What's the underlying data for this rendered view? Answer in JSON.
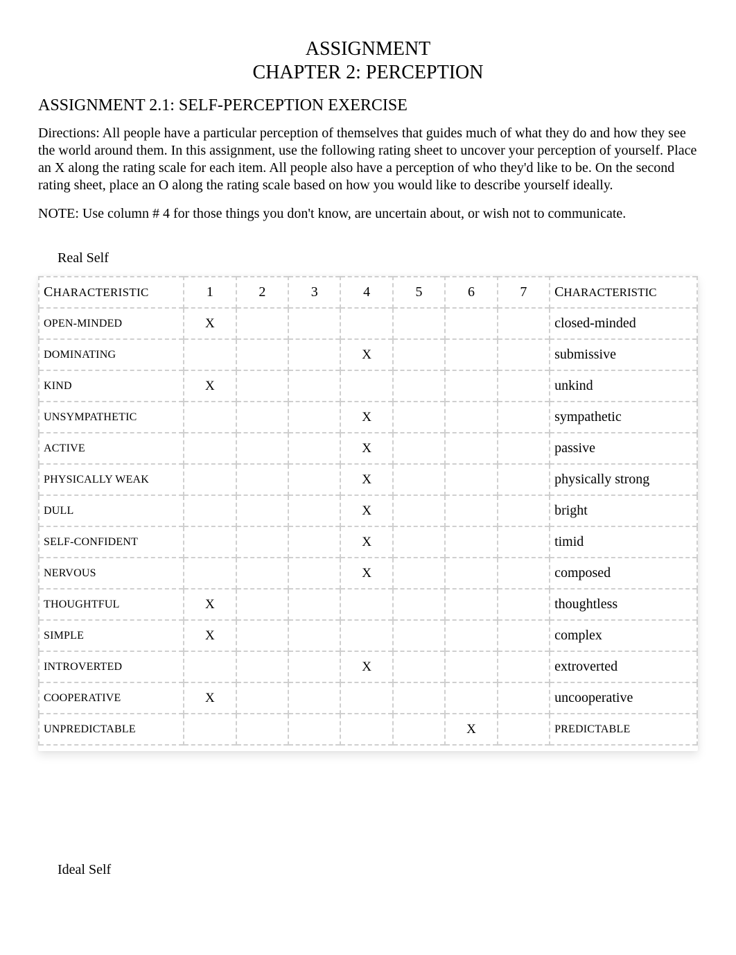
{
  "header": {
    "title_main": "ASSIGNMENT",
    "title_sub": "CHAPTER 2: PERCEPTION"
  },
  "assignment_heading": "ASSIGNMENT 2.1: SELF-PERCEPTION EXERCISE",
  "directions": "Directions:  All people have a particular perception of themselves that guides much of what they do and how they see the world around them. In this assignment, use the following rating sheet to uncover your perception of yourself. Place an X along the rating scale for each item. All people also have a perception of who they'd like to be. On the second rating sheet, place an O along the rating scale based on how you would like to describe yourself ideally.",
  "note": "NOTE:  Use column # 4 for those things you don't know, are uncertain about, or wish not to communicate.",
  "sections": {
    "real_self_label": "Real Self",
    "ideal_self_label": "Ideal Self"
  },
  "table": {
    "header_left_cap": "C",
    "header_left_rest": "HARACTERISTIC",
    "header_right_cap": "C",
    "header_right_rest": "HARACTERISTIC",
    "columns": [
      "1",
      "2",
      "3",
      "4",
      "5",
      "6",
      "7"
    ],
    "rows": [
      {
        "left": "OPEN-MINDED",
        "right": "closed-minded",
        "mark_col": 1,
        "right_smallcaps": false
      },
      {
        "left": "DOMINATING",
        "right": "submissive",
        "mark_col": 4,
        "right_smallcaps": false
      },
      {
        "left": "KIND",
        "right": "unkind",
        "mark_col": 1,
        "right_smallcaps": false
      },
      {
        "left": "UNSYMPATHETIC",
        "right": "sympathetic",
        "mark_col": 4,
        "right_smallcaps": false
      },
      {
        "left": "ACTIVE",
        "right": "passive",
        "mark_col": 4,
        "right_smallcaps": false
      },
      {
        "left": "PHYSICALLY WEAK",
        "right": "physically strong",
        "mark_col": 4,
        "right_smallcaps": false
      },
      {
        "left": "DULL",
        "right": "bright",
        "mark_col": 4,
        "right_smallcaps": false
      },
      {
        "left": "SELF-CONFIDENT",
        "right": "timid",
        "mark_col": 4,
        "right_smallcaps": false
      },
      {
        "left": "NERVOUS",
        "right": "composed",
        "mark_col": 4,
        "right_smallcaps": false
      },
      {
        "left": "THOUGHTFUL",
        "right": "thoughtless",
        "mark_col": 1,
        "right_smallcaps": false
      },
      {
        "left": "SIMPLE",
        "right": "complex",
        "mark_col": 1,
        "right_smallcaps": false
      },
      {
        "left": "INTROVERTED",
        "right": "extroverted",
        "mark_col": 4,
        "right_smallcaps": false
      },
      {
        "left": "COOPERATIVE",
        "right": "uncooperative",
        "mark_col": 1,
        "right_smallcaps": false
      },
      {
        "left": "UNPREDICTABLE",
        "right": "PREDICTABLE",
        "mark_col": 6,
        "right_smallcaps": true
      }
    ],
    "mark_symbol": "X"
  }
}
